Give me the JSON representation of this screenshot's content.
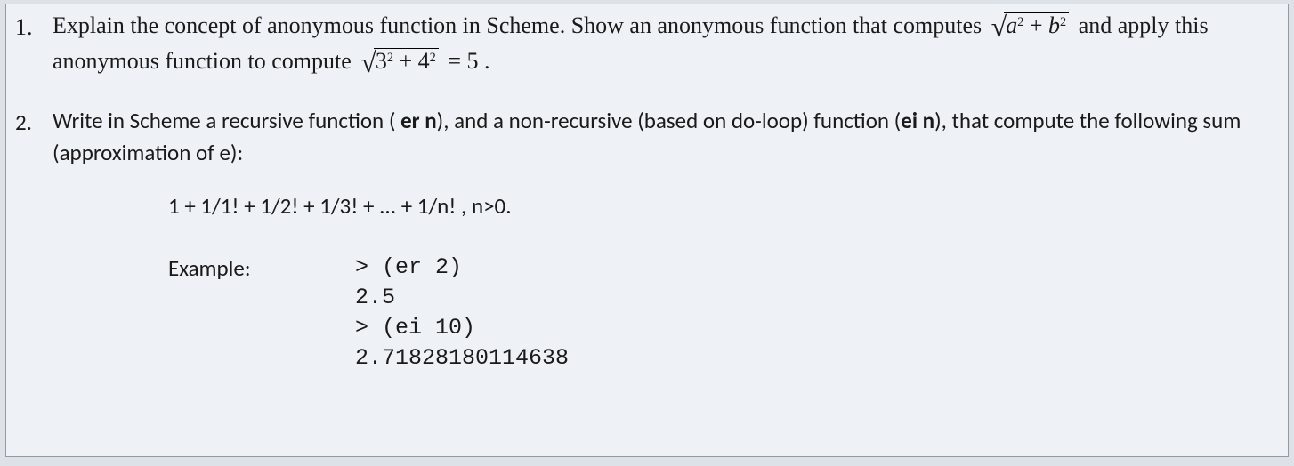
{
  "q1": {
    "number": "1.",
    "pre": "Explain the concept of anonymous function in Scheme. Show an anonymous function that computes ",
    "sqrt1_a": "a",
    "sqrt1_b": "b",
    "mid": " and apply this anonymous function to compute ",
    "sqrt2_a": "3",
    "sqrt2_b": "4",
    "tail": " = 5 .",
    "exp": "2",
    "plus": " + "
  },
  "q2": {
    "number": "2.",
    "t1": "Write in Scheme a recursive function ( ",
    "er": "er  n",
    "t2": "), and a non-recursive (based on do-loop) function (",
    "ei": "ei  n",
    "t3": "), that compute the following sum (approximation of e):",
    "formula": "1 + 1/1! + 1/2! + 1/3! + ... + 1/n! ,   n>0.",
    "example_label": "Example:",
    "code": "> (er 2)\n2.5\n> (ei 10)\n2.71828180114638"
  }
}
